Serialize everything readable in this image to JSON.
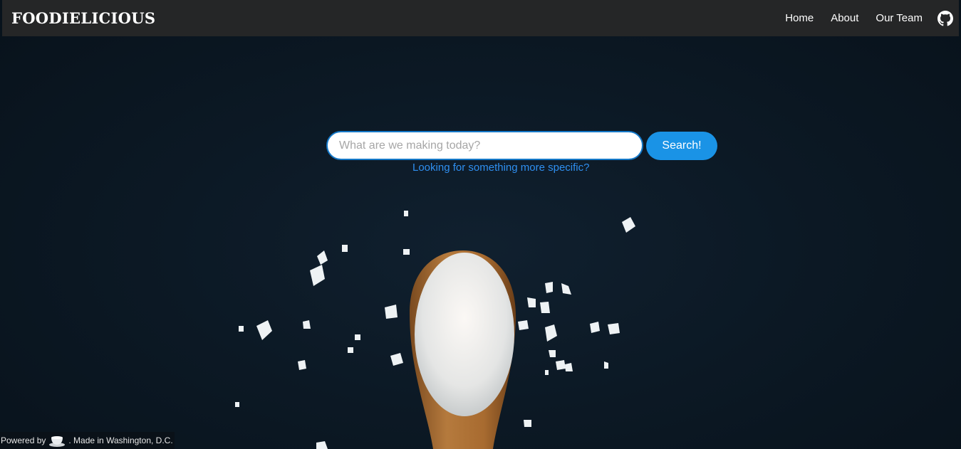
{
  "navbar": {
    "brand": "FOODIELICIOUS",
    "links": [
      {
        "label": "Home"
      },
      {
        "label": "About"
      },
      {
        "label": "Our Team"
      }
    ],
    "github_icon": "github-icon"
  },
  "search": {
    "placeholder": "What are we making today?",
    "value": "",
    "button_label": "Search!",
    "specific_link": "Looking for something more specific?"
  },
  "footer": {
    "powered_by": "Powered by",
    "made_in": ". Made in Washington, D.C.",
    "logo_icon": "teacup-icon"
  },
  "colors": {
    "navbar_bg": "#252627",
    "accent": "#1a93e6",
    "link": "#2f8ff0",
    "background": "#0b1622"
  }
}
